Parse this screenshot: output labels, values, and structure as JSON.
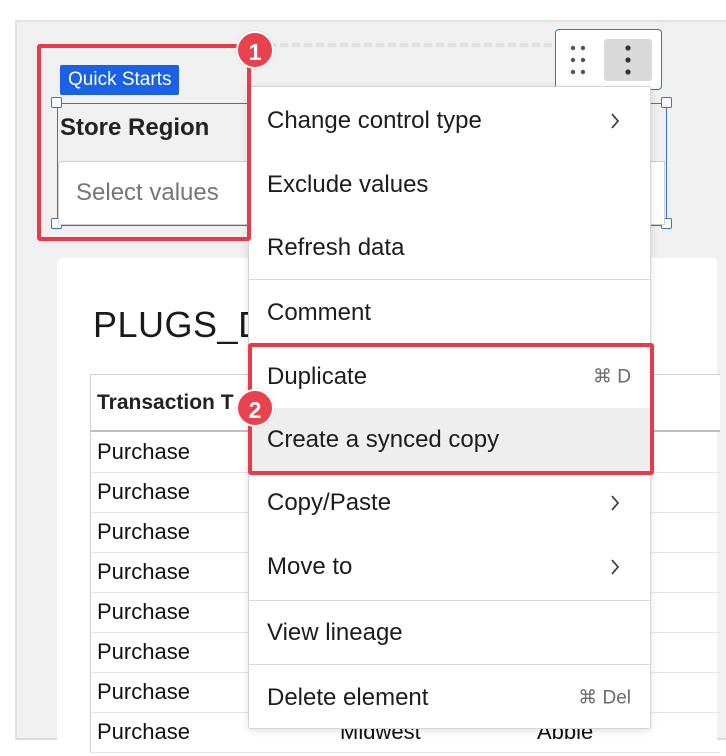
{
  "control": {
    "badge": "Quick Starts",
    "title": "Store Region",
    "placeholder": "Select values"
  },
  "table": {
    "title": "PLUGS_D",
    "column_header": "Transaction T",
    "rows": [
      {
        "c1": "Purchase",
        "c2": "",
        "c3": ""
      },
      {
        "c1": "Purchase",
        "c2": "",
        "c3": ""
      },
      {
        "c1": "Purchase",
        "c2": "",
        "c3": ""
      },
      {
        "c1": "Purchase",
        "c2": "",
        "c3": ""
      },
      {
        "c1": "Purchase",
        "c2": "",
        "c3": ""
      },
      {
        "c1": "Purchase",
        "c2": "",
        "c3": ""
      },
      {
        "c1": "Purchase",
        "c2": "",
        "c3": ""
      },
      {
        "c1": "Purchase",
        "c2": "Midwest",
        "c3": "Abbie"
      }
    ]
  },
  "menu": {
    "items": [
      {
        "label": "Change control type",
        "submenu": true
      },
      {
        "label": "Exclude values"
      },
      {
        "label": "Refresh data"
      },
      {
        "label": "Comment"
      },
      {
        "label": "Duplicate",
        "shortcut": "⌘ D"
      },
      {
        "label": "Create a synced copy"
      },
      {
        "label": "Copy/Paste",
        "submenu": true
      },
      {
        "label": "Move to",
        "submenu": true
      },
      {
        "label": "View lineage"
      },
      {
        "label": "Delete element",
        "shortcut": "⌘ Del"
      }
    ]
  },
  "annotations": {
    "marker_1": "1",
    "marker_2": "2",
    "color": "#ea3a4a"
  },
  "colors": {
    "selection_blue": "#3a6fd8",
    "badge_blue": "#1a61e6",
    "hover_gray": "#eeeeee"
  },
  "icons": {
    "drag": "drag-handle-icon",
    "kebab": "more-vertical-icon",
    "chevron": "chevron-right-icon"
  }
}
